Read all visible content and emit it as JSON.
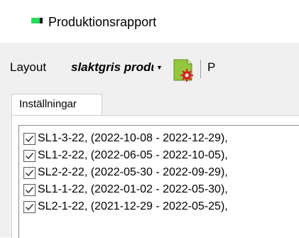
{
  "window": {
    "title": "Produktionsrapport",
    "icon": "app-icon"
  },
  "toolbar": {
    "layout_label": "Layout",
    "layout_value": "slaktgris produktion",
    "dropdown_icon": "chevron-down-icon",
    "settings_icon": "report-settings-icon",
    "next_label": "P"
  },
  "tabs": [
    {
      "label": "Inställningar",
      "selected": true
    }
  ],
  "list": {
    "items": [
      {
        "label": "SL1-3-22, (2022-10-08 - 2022-12-29),",
        "checked": true
      },
      {
        "label": "SL1-2-22, (2022-06-05 - 2022-10-05),",
        "checked": true
      },
      {
        "label": "SL2-2-22, (2022-05-30 - 2022-09-29),",
        "checked": true
      },
      {
        "label": "SL1-1-22, (2022-01-02 - 2022-05-30),",
        "checked": true
      },
      {
        "label": "SL2-1-22, (2021-12-29 - 2022-05-25),",
        "checked": true
      }
    ]
  },
  "colors": {
    "accent_green": "#1fe05a",
    "panel_bg": "#f0f0f0"
  }
}
